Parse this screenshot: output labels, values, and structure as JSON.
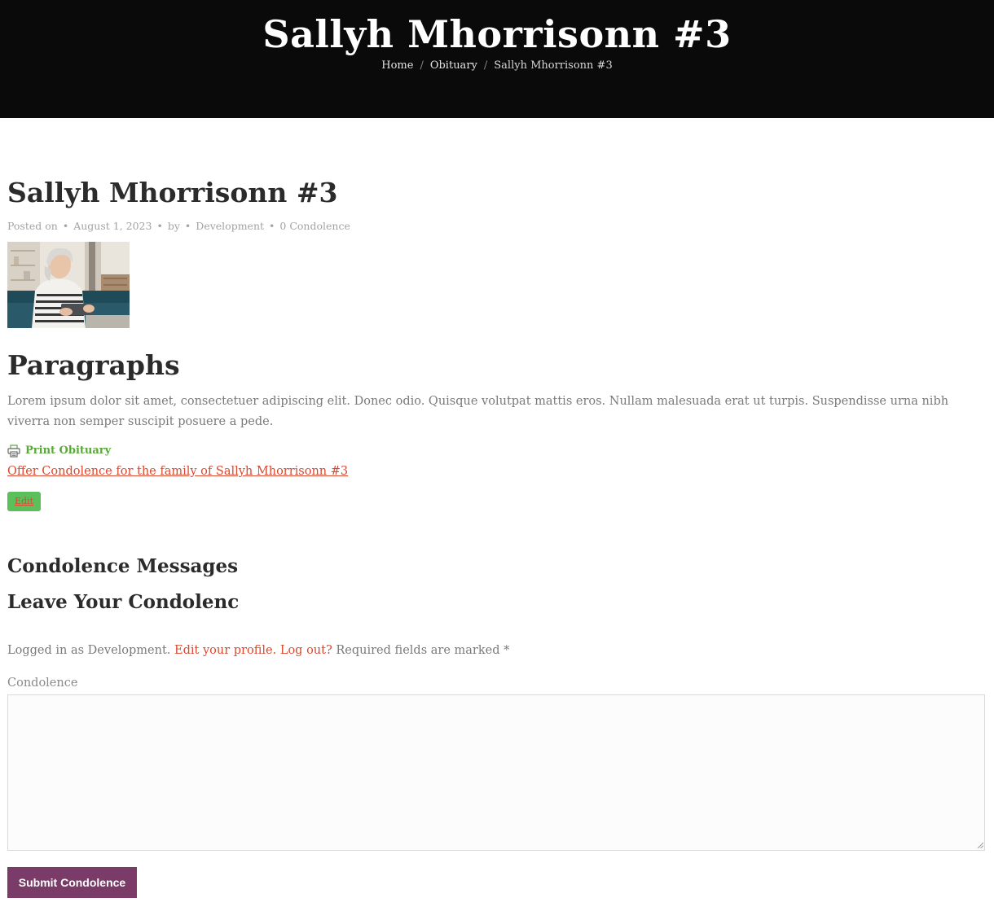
{
  "hero": {
    "title": "Sallyh Mhorrisonn #3",
    "breadcrumb": [
      "Home",
      "Obituary",
      "Sallyh Mhorrisonn #3"
    ]
  },
  "post": {
    "title": "Sallyh Mhorrisonn #3",
    "meta": {
      "posted_on": "Posted on",
      "date": "August 1, 2023",
      "by": "by",
      "author": "Development",
      "condolence_count": "0 Condolence"
    },
    "section_heading": "Paragraphs",
    "body": "Lorem ipsum dolor sit amet, consectetuer adipiscing elit. Donec odio. Quisque volutpat mattis eros. Nullam malesuada erat ut turpis. Suspendisse urna nibh viverra non semper suscipit posuere a pede.",
    "print_label": "Print Obituary",
    "offer_link": "Offer Condolence for the family of Sallyh Mhorrisonn #3",
    "edit_label": "Edit"
  },
  "condolence": {
    "messages_heading": "Condolence Messages",
    "leave_heading": "Leave Your Condolenc",
    "logged_in_as": "Logged in as Development.",
    "edit_profile": "Edit your profile.",
    "log_out": "Log out?",
    "required_note": "Required fields are marked *",
    "field_label": "Condolence",
    "field_value": "",
    "submit_label": "Submit Condolence"
  },
  "colors": {
    "hero_bg": "#0a0a0a",
    "link": "#d9482f",
    "print_green": "#5aa83a",
    "edit_bg": "#5cc05a",
    "submit_bg": "#7a3b69"
  }
}
